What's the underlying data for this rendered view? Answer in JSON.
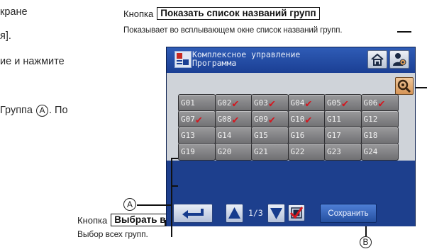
{
  "page_text": {
    "line1": "кране",
    "line2": "я].",
    "line3": "ие и нажмите",
    "line4_prefix": "Группа",
    "line4_circle": "A",
    "line4_suffix": ". По"
  },
  "callout_show_names": {
    "prefix": "Кнопка",
    "label": "Показать список названий групп",
    "description": "Показывает во всплывающем окне список названий групп."
  },
  "callout_select_all": {
    "prefix": "Кнопка",
    "label": "Выбрать все",
    "description": "Выбор всех групп."
  },
  "markers": {
    "a": "A",
    "b": "B"
  },
  "screen": {
    "title_line1": "Комплексное управление",
    "title_line2": "Программа",
    "icons": {
      "app": "program-app-icon",
      "home": "home-icon",
      "user_settings": "user-settings-icon",
      "group_names": "group-names-icon",
      "back": "back-arrow-icon",
      "up": "arrow-up-icon",
      "down": "arrow-down-icon",
      "select_all": "select-all-icon"
    },
    "groups": [
      {
        "label": "G01",
        "checked": false
      },
      {
        "label": "G02",
        "checked": true
      },
      {
        "label": "G03",
        "checked": true
      },
      {
        "label": "G04",
        "checked": true
      },
      {
        "label": "G05",
        "checked": true
      },
      {
        "label": "G06",
        "checked": true
      },
      {
        "label": "G07",
        "checked": true
      },
      {
        "label": "G08",
        "checked": true
      },
      {
        "label": "G09",
        "checked": true
      },
      {
        "label": "G10",
        "checked": true
      },
      {
        "label": "G11",
        "checked": false
      },
      {
        "label": "G12",
        "checked": false
      },
      {
        "label": "G13",
        "checked": false
      },
      {
        "label": "G14",
        "checked": false
      },
      {
        "label": "G15",
        "checked": false
      },
      {
        "label": "G16",
        "checked": false
      },
      {
        "label": "G17",
        "checked": false
      },
      {
        "label": "G18",
        "checked": false
      },
      {
        "label": "G19",
        "checked": false
      },
      {
        "label": "G20",
        "checked": false
      },
      {
        "label": "G21",
        "checked": false
      },
      {
        "label": "G22",
        "checked": false
      },
      {
        "label": "G23",
        "checked": false
      },
      {
        "label": "G24",
        "checked": false
      }
    ],
    "page_indicator": "1/3",
    "save_label": "Сохранить",
    "colors": {
      "screen_bg": "#1d3f8d",
      "panel_bg": "#cfd3d9",
      "check": "#d4171f",
      "names_button": "#e0a86f"
    }
  }
}
